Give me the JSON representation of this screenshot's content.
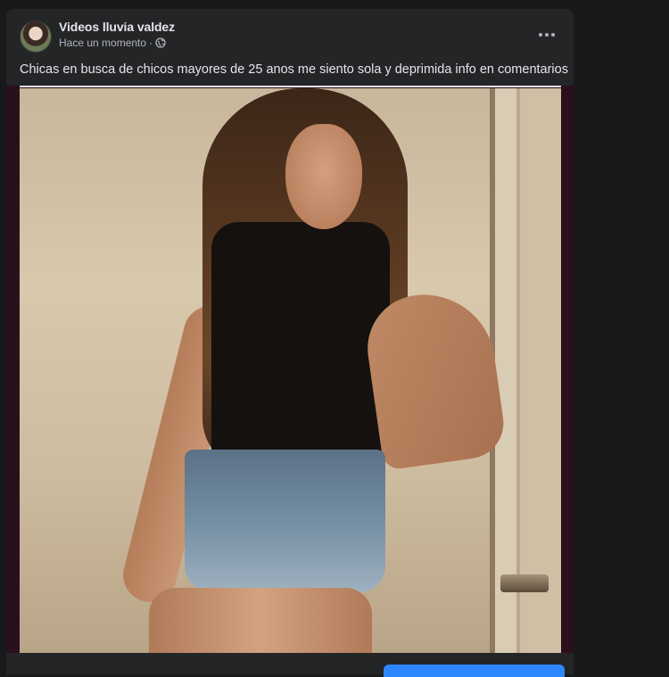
{
  "post": {
    "author": "Videos lluvia valdez",
    "timestamp": "Hace un momento",
    "separator": "·",
    "privacy_icon": "globe-icon",
    "more_icon": "more-options-icon",
    "caption": "Chicas en busca de chicos mayores de 25 anos me siento sola y deprimida info en comentarios"
  },
  "colors": {
    "page_background": "#18191a",
    "card_background": "#242526",
    "primary_text": "#e4e6eb",
    "secondary_text": "#b0b3b8",
    "accent_blue": "#2d88ff"
  }
}
